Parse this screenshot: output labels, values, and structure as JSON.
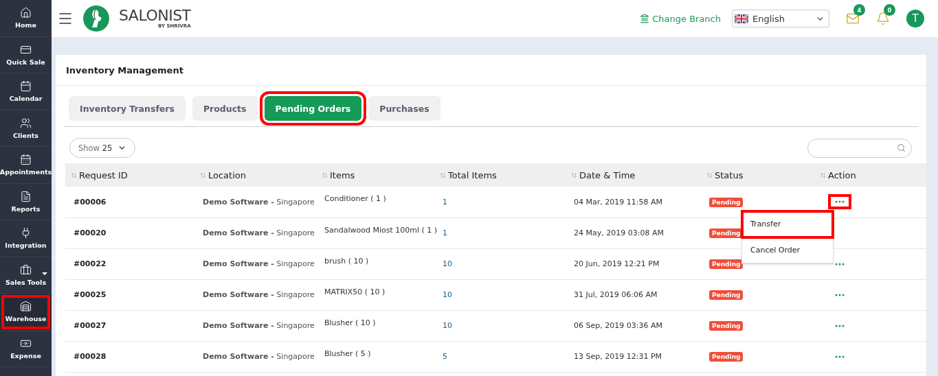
{
  "sidebar": {
    "items": [
      {
        "label": "Home",
        "highlighted": false,
        "has_submenu": false
      },
      {
        "label": "Quick Sale",
        "highlighted": false,
        "has_submenu": false
      },
      {
        "label": "Calendar",
        "highlighted": false,
        "has_submenu": false
      },
      {
        "label": "Clients",
        "highlighted": false,
        "has_submenu": false
      },
      {
        "label": "Appointments",
        "highlighted": false,
        "has_submenu": false
      },
      {
        "label": "Reports",
        "highlighted": false,
        "has_submenu": false
      },
      {
        "label": "Integration",
        "highlighted": false,
        "has_submenu": false
      },
      {
        "label": "Sales Tools",
        "highlighted": false,
        "has_submenu": true
      },
      {
        "label": "Warehouse",
        "highlighted": true,
        "has_submenu": false
      },
      {
        "label": "Expense",
        "highlighted": false,
        "has_submenu": false
      }
    ]
  },
  "header": {
    "brand": "SALONIST",
    "brand_sub": "BY SHRIVRA",
    "change_branch": "Change Branch",
    "language": "English",
    "mail_count": "4",
    "notification_count": "0",
    "avatar": "T"
  },
  "page": {
    "title": "Inventory Management",
    "tabs": [
      {
        "label": "Inventory Transfers",
        "selected": false,
        "highlighted": false
      },
      {
        "label": "Products",
        "selected": false,
        "highlighted": false
      },
      {
        "label": "Pending Orders",
        "selected": true,
        "highlighted": true
      },
      {
        "label": "Purchases",
        "selected": false,
        "highlighted": false
      }
    ],
    "show_entries": {
      "label": "Show",
      "value": "25"
    },
    "table": {
      "columns": [
        "Request ID",
        "Location",
        "Items",
        "Total Items",
        "Date & Time",
        "Status",
        "Action"
      ],
      "rows": [
        {
          "id": "#00006",
          "location": "**Demo Software -** Singapore",
          "items": "Conditioner ( 1 )",
          "total": "1",
          "date": "04 Mar, 2019 11:58 AM",
          "status": "Pending",
          "action": true,
          "menu_open": true
        },
        {
          "id": "#00020",
          "location": "**Demo Software -** Singapore",
          "items": "Sandalwood Miost 100ml ( 1 )",
          "total": "1",
          "date": "24 May, 2019 03:08 AM",
          "status": "Pending",
          "action": false,
          "menu_open": false
        },
        {
          "id": "#00022",
          "location": "**Demo Software -** Singapore",
          "items": "brush ( 10 )",
          "total": "10",
          "date": "20 Jun, 2019 12:21 PM",
          "status": "Pending",
          "action": true,
          "menu_open": false
        },
        {
          "id": "#00025",
          "location": "**Demo Software -** Singapore",
          "items": "MATRIX50 ( 10 )",
          "total": "10",
          "date": "31 Jul, 2019 06:06 AM",
          "status": "Pending",
          "action": true,
          "menu_open": false
        },
        {
          "id": "#00027",
          "location": "**Demo Software -** Singapore",
          "items": "Blusher ( 10 )",
          "total": "10",
          "date": "06 Sep, 2019 03:36 AM",
          "status": "Pending",
          "action": true,
          "menu_open": false
        },
        {
          "id": "#00028",
          "location": "**Demo Software -** Singapore",
          "items": "Blusher ( 5 )",
          "total": "5",
          "date": "13 Sep, 2019 12:31 PM",
          "status": "Pending",
          "action": true,
          "menu_open": false
        }
      ]
    },
    "action_menu": [
      {
        "label": "Transfer",
        "highlighted": true
      },
      {
        "label": "Cancel Order",
        "highlighted": false
      }
    ]
  }
}
